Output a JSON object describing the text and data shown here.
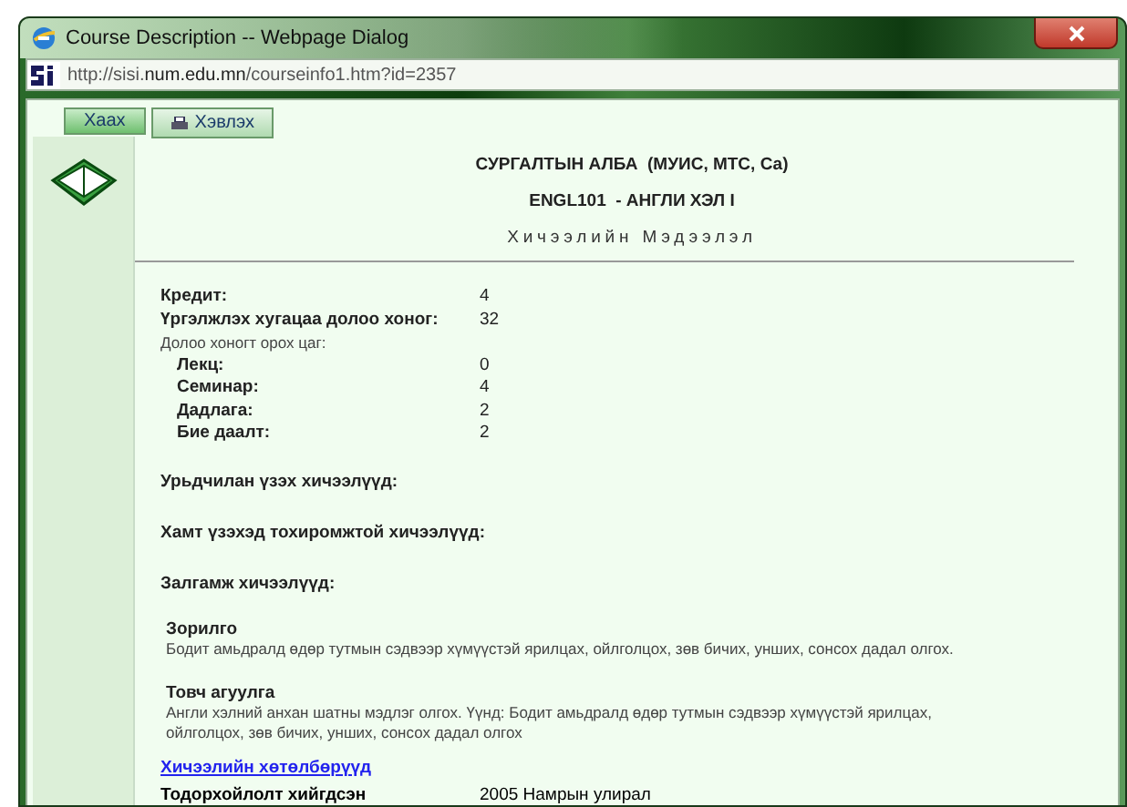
{
  "window": {
    "title": "Course Description -- Webpage Dialog"
  },
  "address_bar": {
    "url": "http://sisi.**num.edu.mn**/courseinfo1.htm?id=2357"
  },
  "toolbar": [
    {
      "label": "Хаах",
      "kind": "close"
    },
    {
      "label": "Хэвлэх",
      "kind": "print"
    }
  ],
  "header": {
    "department": "СУРГАЛТЫН АЛБА  (МУИС, МТС, Са)",
    "course": "ENGL101  - АНГЛИ ХЭЛ I",
    "section_title": "Хичээлийн Мэдээлэл"
  },
  "info_rows": [
    {
      "label": "Кредит:",
      "value": "4",
      "kind": "main"
    },
    {
      "label": "Үргэлжлэх хугацаа долоо хоног:",
      "value": "32",
      "kind": "main"
    },
    {
      "label": "Долоо хоногт орох цаг:",
      "kind": "note"
    },
    {
      "label": "Лекц:",
      "value": "0",
      "kind": "sub"
    },
    {
      "label": "Семинар:",
      "value": "4",
      "kind": "sub"
    },
    {
      "label": "Дадлага:",
      "value": "2",
      "kind": "sub"
    },
    {
      "label": "Бие даалт:",
      "value": "2",
      "kind": "sub"
    }
  ],
  "course_lists": [
    "Урьдчилан үзэх хичээлүүд:",
    "Хамт үзэхэд тохиромжтой хичээлүүд:",
    "Залгамж хичээлүүд:"
  ],
  "descriptions": [
    {
      "title": "Зорилго",
      "text": "Бодит амьдралд өдөр тутмын сэдвээр хүмүүстэй ярилцах, ойлголцох, зөв бичих, унших, сонсох дадал олгох."
    },
    {
      "title": "Товч агуулга",
      "text": "Англи хэлний анхан шатны мэдлэг олгох. Үүнд: Бодит амьдралд өдөр тутмын сэдвээр хүмүүстэй ярилцах, ойлголцох, зөв бичих, унших, сонсох дадал олгох"
    }
  ],
  "program_link": "Хичээлийн хөтөлбөрүүд",
  "footer_row": {
    "label": "Тодорхойлолт хийгдсэн",
    "value": "2005 Намрын улирал"
  }
}
